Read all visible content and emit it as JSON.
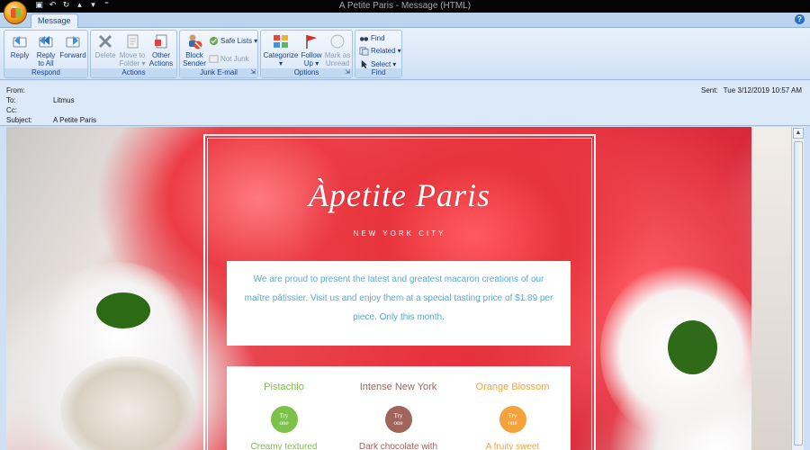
{
  "window": {
    "title": "A Petite Paris - Message (HTML)"
  },
  "tabs": [
    {
      "label": "Message"
    }
  ],
  "ribbon": {
    "respond": {
      "label": "Respond",
      "reply": "Reply",
      "reply_all_1": "Reply",
      "reply_all_2": "to All",
      "forward": "Forward"
    },
    "actions": {
      "label": "Actions",
      "delete": "Delete",
      "move_1": "Move to",
      "move_2": "Folder",
      "other_1": "Other",
      "other_2": "Actions"
    },
    "junk": {
      "label": "Junk E-mail",
      "block_1": "Block",
      "block_2": "Sender",
      "safe_lists": "Safe Lists",
      "not_junk": "Not Junk"
    },
    "options": {
      "label": "Options",
      "categorize": "Categorize",
      "follow_1": "Follow",
      "follow_2": "Up",
      "mark_1": "Mark as",
      "mark_2": "Unread"
    },
    "find": {
      "label": "Find",
      "find": "Find",
      "related": "Related",
      "select": "Select"
    }
  },
  "header": {
    "from_label": "From:",
    "from_value": "",
    "to_label": "To:",
    "to_value": "Litmus",
    "cc_label": "Cc:",
    "cc_value": "",
    "subject_label": "Subject:",
    "subject_value": "A Petite Paris",
    "sent_label": "Sent:",
    "sent_value": "Tue 3/12/2019 10:57 AM"
  },
  "email": {
    "logo": "Àpetite Paris",
    "city": "NEW YORK CITY",
    "intro": "We are proud to present the latest and greatest macaron creations of our maître pâtissier. Visit us and enjoy them at a special tasting price of $1.89 per piece. Only this month.",
    "flavors": [
      {
        "name": "Pistachio",
        "button": "Try one",
        "desc": "Creamy textured",
        "color": "#7cc24a"
      },
      {
        "name": "Intense New York",
        "button": "Try one",
        "desc": "Dark chocolate with",
        "color": "#a0645a"
      },
      {
        "name": "Orange Blossom",
        "button": "Try one",
        "desc": "A fruity sweet",
        "color": "#f5a23a"
      }
    ]
  },
  "colors": {
    "accent_blue": "#15428b",
    "intro_text": "#5aa9cf"
  }
}
